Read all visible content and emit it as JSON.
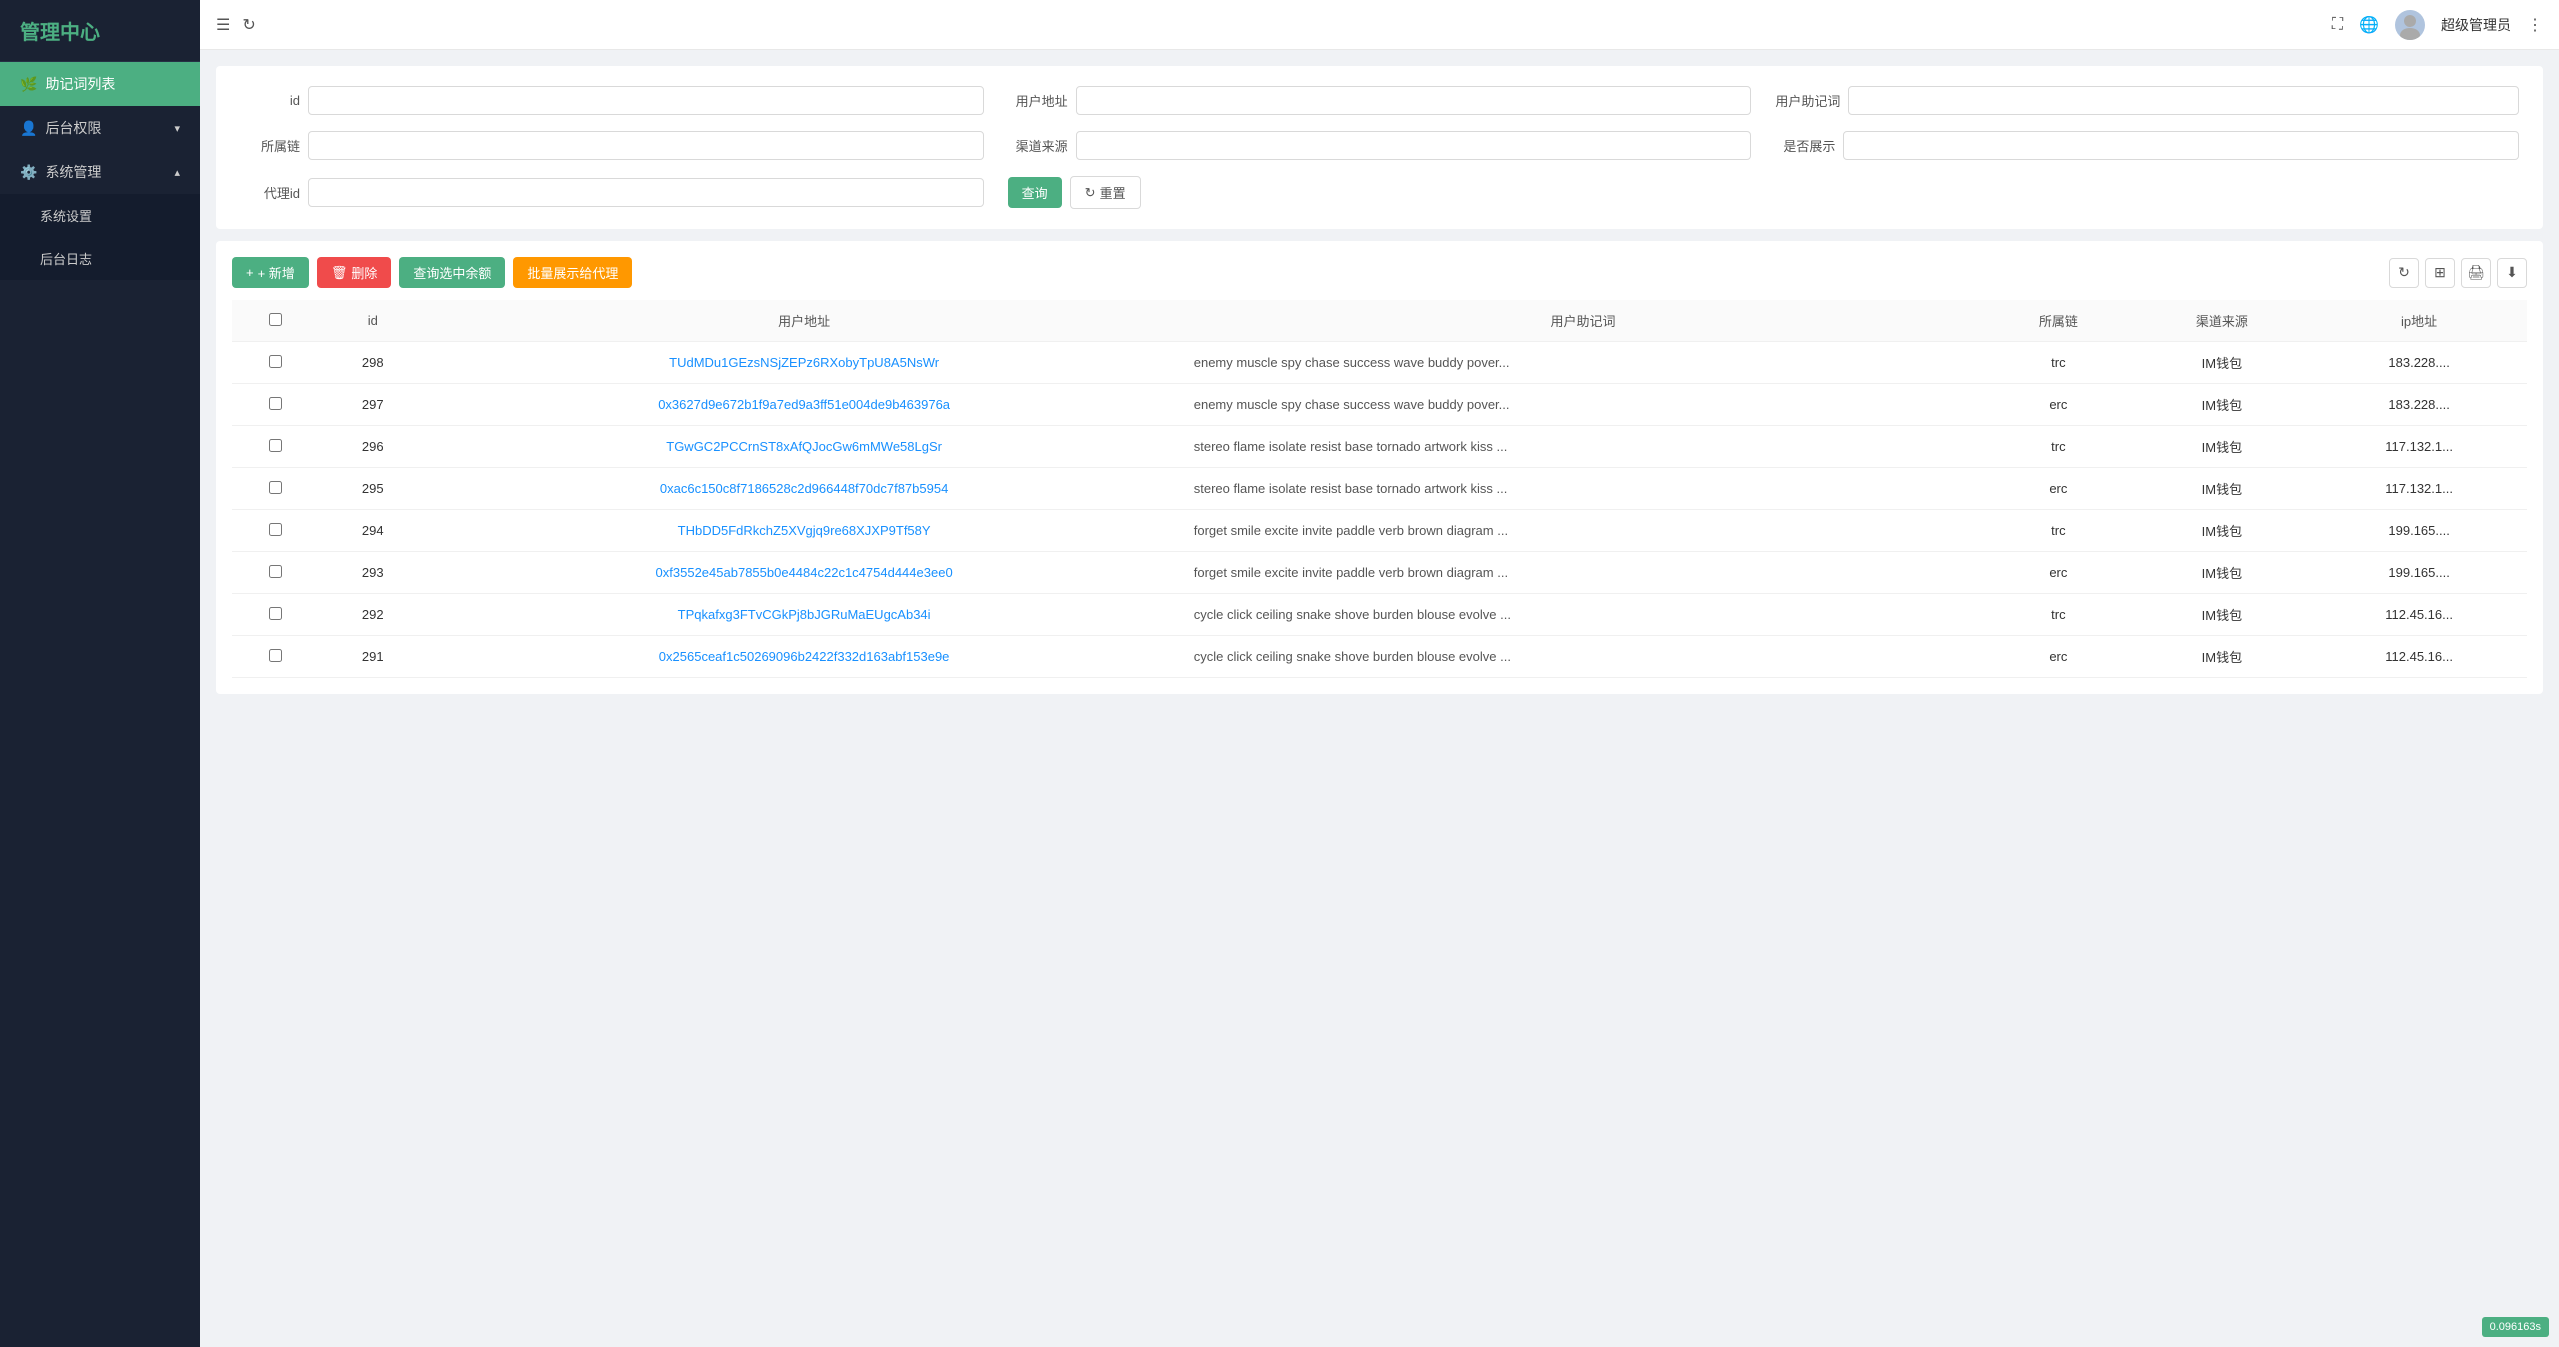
{
  "sidebar": {
    "logo": "管理中心",
    "items": [
      {
        "id": "mnemonic-list",
        "label": "助记词列表",
        "icon": "🌿",
        "active": true,
        "sub": false
      },
      {
        "id": "backend-permission",
        "label": "后台权限",
        "icon": "👤",
        "active": false,
        "sub": true,
        "expanded": false
      },
      {
        "id": "system-management",
        "label": "系统管理",
        "icon": "⚙️",
        "active": false,
        "sub": true,
        "expanded": true
      }
    ],
    "sub_items": [
      {
        "id": "system-settings",
        "label": "系统设置"
      },
      {
        "id": "backend-log",
        "label": "后台日志"
      }
    ]
  },
  "header": {
    "username": "超级管理员",
    "toggle_icon": "☰",
    "refresh_icon": "↻",
    "fullscreen_icon": "⛶",
    "globe_icon": "🌐",
    "more_icon": "⋮"
  },
  "search_form": {
    "fields": [
      {
        "id": "id",
        "label": "id",
        "placeholder": ""
      },
      {
        "id": "user_address",
        "label": "用户地址",
        "placeholder": ""
      },
      {
        "id": "user_mnemonic",
        "label": "用户助记词",
        "placeholder": ""
      },
      {
        "id": "chain",
        "label": "所属链",
        "placeholder": ""
      },
      {
        "id": "channel",
        "label": "渠道来源",
        "placeholder": ""
      },
      {
        "id": "show",
        "label": "是否展示",
        "placeholder": ""
      },
      {
        "id": "agent_id",
        "label": "代理id",
        "placeholder": ""
      }
    ],
    "query_btn": "查询",
    "reset_btn": "重置"
  },
  "toolbar": {
    "add_btn": "+ 新增",
    "delete_btn": "删除",
    "query_balance_btn": "查询选中余额",
    "batch_show_btn": "批量展示给代理"
  },
  "table": {
    "columns": [
      "id",
      "用户地址",
      "用户助记词",
      "所属链",
      "渠道来源",
      "ip地址"
    ],
    "rows": [
      {
        "id": 298,
        "address": "TUdMDu1GEzsNSjZEPz6RXobyTpU8A5NsWr",
        "mnemonic": "enemy muscle spy chase success wave buddy pover...",
        "chain": "trc",
        "channel": "IM钱包",
        "ip": "183.228...."
      },
      {
        "id": 297,
        "address": "0x3627d9e672b1f9a7ed9a3ff51e004de9b463976a",
        "mnemonic": "enemy muscle spy chase success wave buddy pover...",
        "chain": "erc",
        "channel": "IM钱包",
        "ip": "183.228...."
      },
      {
        "id": 296,
        "address": "TGwGC2PCCrnST8xAfQJocGw6mMWe58LgSr",
        "mnemonic": "stereo flame isolate resist base tornado artwork kiss ...",
        "chain": "trc",
        "channel": "IM钱包",
        "ip": "117.132.1..."
      },
      {
        "id": 295,
        "address": "0xac6c150c8f7186528c2d966448f70dc7f87b5954",
        "mnemonic": "stereo flame isolate resist base tornado artwork kiss ...",
        "chain": "erc",
        "channel": "IM钱包",
        "ip": "117.132.1..."
      },
      {
        "id": 294,
        "address": "THbDD5FdRkchZ5XVgjq9re68XJXP9Tf58Y",
        "mnemonic": "forget smile excite invite paddle verb brown diagram ...",
        "chain": "trc",
        "channel": "IM钱包",
        "ip": "199.165...."
      },
      {
        "id": 293,
        "address": "0xf3552e45ab7855b0e4484c22c1c4754d444e3ee0",
        "mnemonic": "forget smile excite invite paddle verb brown diagram ...",
        "chain": "erc",
        "channel": "IM钱包",
        "ip": "199.165...."
      },
      {
        "id": 292,
        "address": "TPqkafxg3FTvCGkPj8bJGRuMaEUgcAb34i",
        "mnemonic": "cycle click ceiling snake shove burden blouse evolve ...",
        "chain": "trc",
        "channel": "IM钱包",
        "ip": "112.45.16..."
      },
      {
        "id": 291,
        "address": "0x2565ceaf1c50269096b2422f332d163abf153e9e",
        "mnemonic": "cycle click ceiling snake shove burden blouse evolve ...",
        "chain": "erc",
        "channel": "IM钱包",
        "ip": "112.45.16..."
      }
    ]
  },
  "version": "0.096163s"
}
